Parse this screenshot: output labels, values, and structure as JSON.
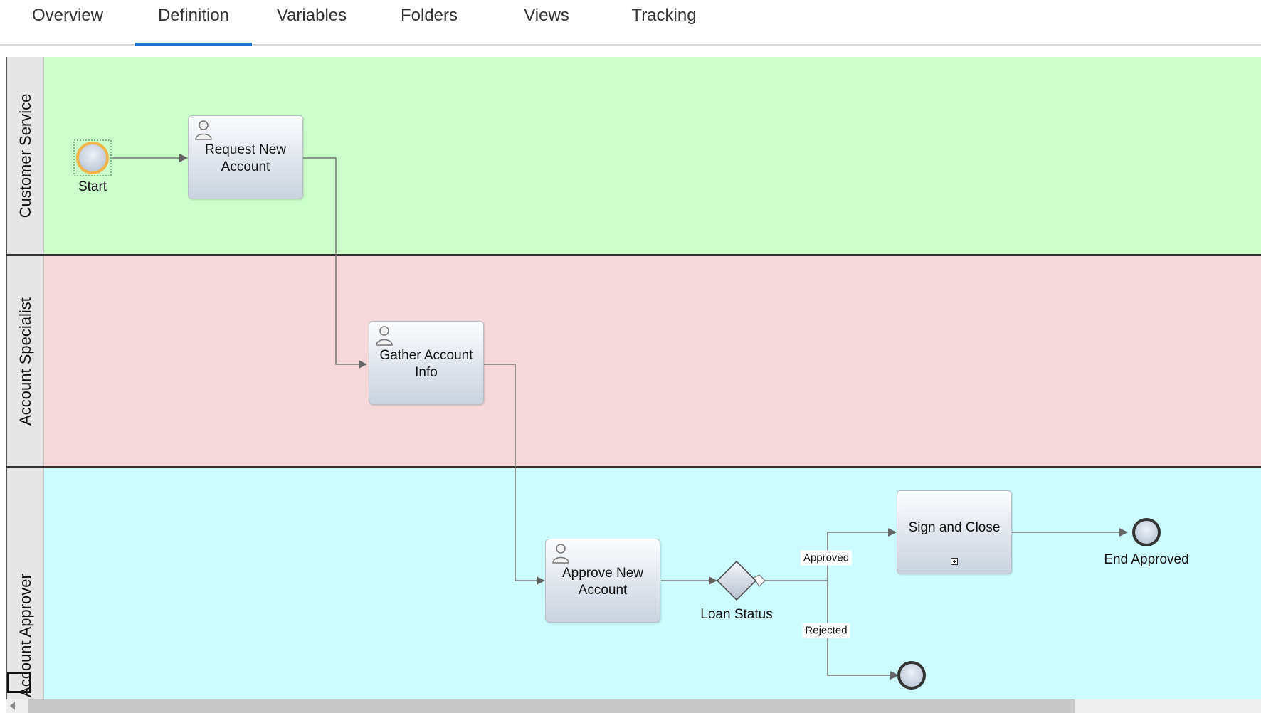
{
  "tabs": [
    {
      "label": "Overview",
      "active": false
    },
    {
      "label": "Definition",
      "active": true
    },
    {
      "label": "Variables",
      "active": false
    },
    {
      "label": "Folders",
      "active": false
    },
    {
      "label": "Views",
      "active": false
    },
    {
      "label": "Tracking",
      "active": false
    }
  ],
  "lanes": [
    {
      "title": "Customer Service",
      "color": "#ccffcc"
    },
    {
      "title": "Account Specialist",
      "color": "#f5d9da"
    },
    {
      "title": "Account Approver",
      "color": "#ccfcff"
    }
  ],
  "nodes": {
    "start_label": "Start",
    "task_request": "Request New Account",
    "task_gather": "Gather Account Info",
    "task_approve": "Approve New Account",
    "gateway_label": "Loan Status",
    "task_sign": "Sign and Close",
    "end_approved_label": "End Approved"
  },
  "edges": {
    "approved_label": "Approved",
    "rejected_label": "Rejected"
  },
  "icons": {
    "task_type": "user-icon",
    "subprocess": "subprocess-expand-icon"
  },
  "colors": {
    "accent_tab": "#1f6fd6",
    "start_ring": "#f0b44a",
    "end_stroke": "#333333"
  }
}
